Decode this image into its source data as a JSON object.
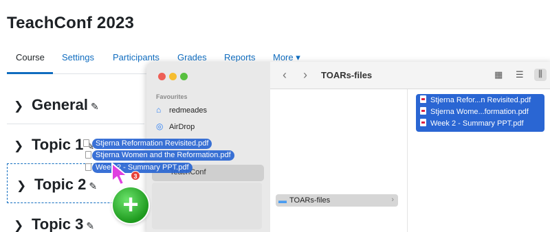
{
  "course": {
    "title": "TeachConf 2023"
  },
  "nav": {
    "tabs": [
      "Course",
      "Settings",
      "Participants",
      "Grades",
      "Reports",
      "More ▾"
    ],
    "active": "Course"
  },
  "sections": [
    {
      "name": "General"
    },
    {
      "name": "Topic 1"
    },
    {
      "name": "Topic 2"
    },
    {
      "name": "Topic 3"
    }
  ],
  "finder": {
    "sidebar": {
      "heading": "Favourites",
      "items": [
        {
          "label": "redmeades",
          "icon": "home-icon"
        },
        {
          "label": "AirDrop",
          "icon": "airdrop-icon"
        }
      ],
      "highlighted": "TeachConf"
    },
    "toolbar": {
      "title": "TOARs-files"
    },
    "folder": "TOARs-files",
    "selected_files": [
      "Stjerna Refor...n Revisited.pdf",
      "Stjerna Wome...formation.pdf",
      "Week 2 - Summary PPT.pdf"
    ]
  },
  "drag": {
    "items": [
      "Stjerna Reformation Revisited.pdf",
      "Stjerna Women and the Reformation.pdf",
      "Week 2 - Summary PPT.pdf"
    ],
    "count": "3"
  },
  "colors": {
    "link": "#0f6cbf",
    "selection": "#2a66d3",
    "badge": "#e8413a",
    "plus": "#1e9a1e"
  }
}
